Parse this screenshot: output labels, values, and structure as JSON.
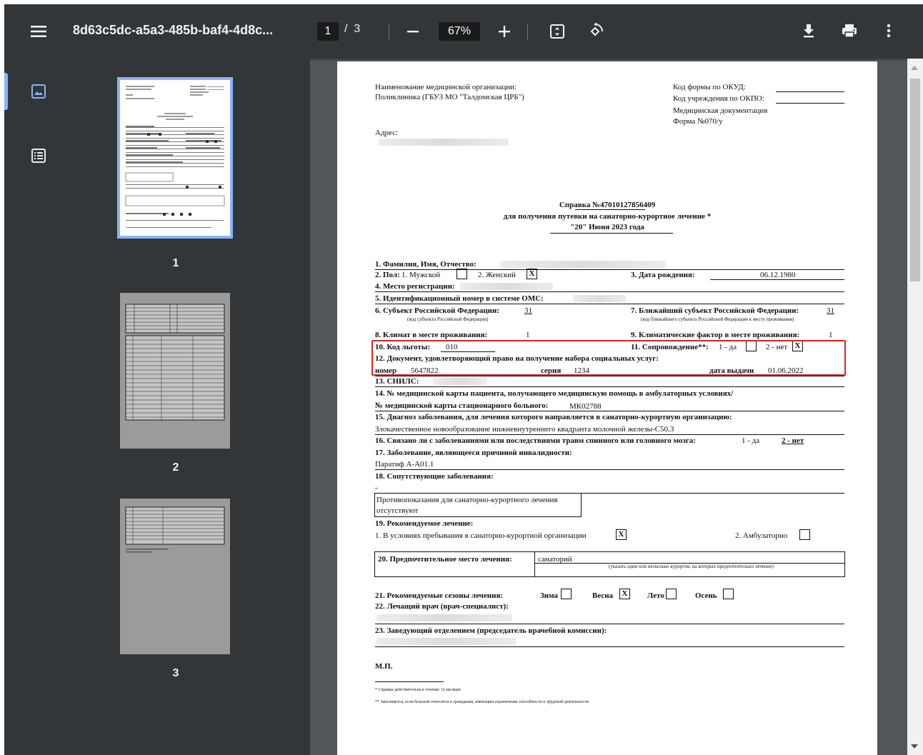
{
  "toolbar": {
    "title": "8d63c5dc-a5a3-485b-baf4-4d8c...",
    "current_page": "1",
    "page_sep": "/",
    "total_pages": "3",
    "zoom": "67%"
  },
  "sidebar": {
    "thumbnails": [
      {
        "label": "1"
      },
      {
        "label": "2"
      },
      {
        "label": "3"
      }
    ]
  },
  "document": {
    "org_label": "Наименование медицинской организации:",
    "org_name": "Поликлиника (ГБУЗ МО \"Талдомская ЦРБ\")",
    "okud_label": "Код формы по ОКУД:",
    "okpo_label": "Код учреждения по ОКПО:",
    "med_doc": "Медицинская документация",
    "form_no": "Форма №070/у",
    "address_label": "Адрес:",
    "cert_title": "Справка №47010127856409",
    "cert_subtitle": "для получения путевки на санаторно-курортное лечение *",
    "cert_date": "\"20\" Июня 2023 года",
    "f1": "1. Фамилия, Имя, Отчество:",
    "f2": "2. Пол:",
    "f2_male": "1. Мужской",
    "f2_female": "2. Женский",
    "f2_mark": "X",
    "f3": "3. Дата рождения:",
    "f3_value": "06.12.1980",
    "f4": "4. Место регистрации:",
    "f5": "5. Идентификационный номер в системе ОМС:",
    "f6": "6. Субъект Российской Федерации:",
    "f6_value": "31",
    "f6_note": "(код субъекта Российской Федерации)",
    "f7": "7. Ближайший субъект Российской Федерации:",
    "f7_value": "31",
    "f7_note": "(код ближайшего субъекта Российской Федерации к месту проживания)",
    "f8": "8. Климат в месте проживания:",
    "f8_value": "1",
    "f9": "9. Климатические фактор в месте проживания:",
    "f9_value": "1",
    "f10": "10. Код льготы:",
    "f10_value": "010",
    "f11": "11. Сопровождение**:",
    "f11_yes": "1 - да",
    "f11_no": "2 - нет",
    "f11_mark": "X",
    "f12": "12. Документ, удовлетворяющий право на получение набора социальных услуг:",
    "f12_number_label": "номер",
    "f12_number": "5647822",
    "f12_series_label": "серия",
    "f12_series": "1234",
    "f12_date_label": "дата выдачи",
    "f12_date": "01.06.2022",
    "f13": "13. СНИЛС:",
    "f14a": "14. № медицинской карты пациента, получающего медицинскую помощь в амбулаторных условиях/",
    "f14b": "№ медицинской карты стационарного больного:",
    "f14_value": "МК02788",
    "f15": "15. Диагноз заболевания, для лечения которого направляется в санаторно-курортную организацию:",
    "f15_value": "Злокачественное новообразование нижневнутреннего квадранта молочной железы-С50.3",
    "f16": "16. Связано ли с заболеваниями или последствиями травм спинного или головного мозга:",
    "f16_yes": "1 - да",
    "f16_no": "2 - нет",
    "f17": "17. Заболевание, являющееся причиной инвалидности:",
    "f17_value": "Паратиф А-А01.1",
    "f18": "18. Сопутствующие заболевания:",
    "f18_value": "-",
    "contra_line1": "Противопоказания для санаторно-курортного лечения",
    "contra_line2": "отсутствуют",
    "f19": "19. Рекомендуемое лечение:",
    "f19_opt1": "1. В условиях пребывания в санаторно-курортной организации",
    "f19_mark": "X",
    "f19_opt2": "2. Амбулаторно",
    "f20": "20. Предпочтительное место лечения:",
    "f20_value": "санаторий",
    "f20_note": "(указать один или несколько курортов, на которых предпочтительно лечение)",
    "f21": "21. Рекомендуемые сезоны лечения:",
    "winter": "Зима",
    "spring": "Весна",
    "spring_mark": "X",
    "summer": "Лето",
    "autumn": "Осень",
    "f22": "22. Лечащий врач (врач-специалист):",
    "f23": "23. Заведующий отделением (председатель врачебной комиссии):",
    "stamp": "М.П.",
    "foot1": "* Справка действительна в течение 12 месяцев",
    "foot2": "** Заполняется, если больной относится к гражданам, имеющим ограничение способности к трудовой деятельности"
  },
  "colors": {
    "toolbar_bg": "#323639",
    "viewer_bg": "#525659",
    "selection": "#8ab4f8",
    "highlight": "#d32727"
  },
  "icons": [
    "menu-icon",
    "zoom-out-icon",
    "zoom-in-icon",
    "fit-page-icon",
    "rotate-icon",
    "download-icon",
    "print-icon",
    "more-vert-icon",
    "thumbnail-view-icon",
    "outline-view-icon"
  ]
}
